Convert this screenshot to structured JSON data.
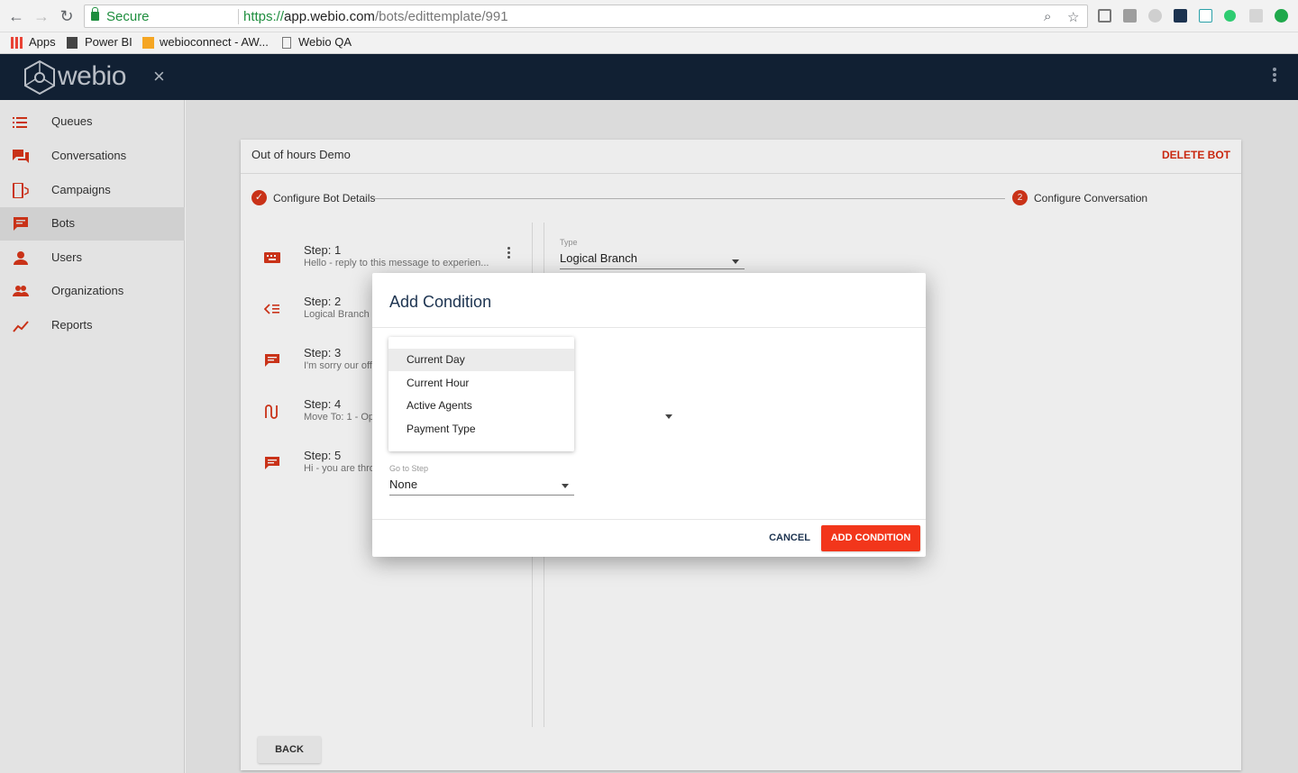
{
  "browser": {
    "secure_label": "Secure",
    "url_scheme": "https://",
    "url_host": "app.webio.com",
    "url_path": "/bots/edittemplate/991",
    "bookmarks": [
      {
        "label": "Apps",
        "icon": "apps-grid-icon"
      },
      {
        "label": "Power BI",
        "icon": "power-bi-icon"
      },
      {
        "label": "webioconnect - AW...",
        "icon": "aws-cube-icon"
      },
      {
        "label": "Webio QA",
        "icon": "page-icon"
      }
    ]
  },
  "app": {
    "logo_text": "webio",
    "close_icon": "×"
  },
  "sidebar": {
    "items": [
      {
        "label": "Queues",
        "icon": "list-icon",
        "active": false
      },
      {
        "label": "Conversations",
        "icon": "chat-icon",
        "active": false
      },
      {
        "label": "Campaigns",
        "icon": "phone-icon",
        "active": false
      },
      {
        "label": "Bots",
        "icon": "message-icon",
        "active": true
      },
      {
        "label": "Users",
        "icon": "person-icon",
        "active": false
      },
      {
        "label": "Organizations",
        "icon": "people-icon",
        "active": false
      },
      {
        "label": "Reports",
        "icon": "trend-icon",
        "active": false
      }
    ],
    "accent_color": "#d9361a"
  },
  "card": {
    "title": "Out of hours Demo",
    "delete_label": "DELETE BOT",
    "stepper": {
      "step1_label": "Configure Bot Details",
      "step2_number": "2",
      "step2_label": "Configure Conversation"
    },
    "steps": [
      {
        "title": "Step: 1",
        "desc": "Hello - reply to this message to experien...",
        "icon": "keyboard-icon"
      },
      {
        "title": "Step: 2",
        "desc": "Logical Branch",
        "icon": "branch-icon"
      },
      {
        "title": "Step: 3",
        "desc": "I'm sorry our off",
        "icon": "message-icon"
      },
      {
        "title": "Step: 4",
        "desc": "Move To: 1 - Op",
        "icon": "route-icon"
      },
      {
        "title": "Step: 5",
        "desc": "Hi - you are thro",
        "icon": "message-icon"
      }
    ],
    "type_label": "Type",
    "type_value": "Logical Branch",
    "back_label": "BACK"
  },
  "dialog": {
    "title": "Add Condition",
    "menu_options": [
      "Current Day",
      "Current Hour",
      "Active Agents",
      "Payment Type"
    ],
    "highlighted_option": "Current Day",
    "goto_label": "Go to Step",
    "goto_value": "None",
    "cancel_label": "CANCEL",
    "add_label": "ADD CONDITION",
    "add_color": "#f2361b"
  }
}
